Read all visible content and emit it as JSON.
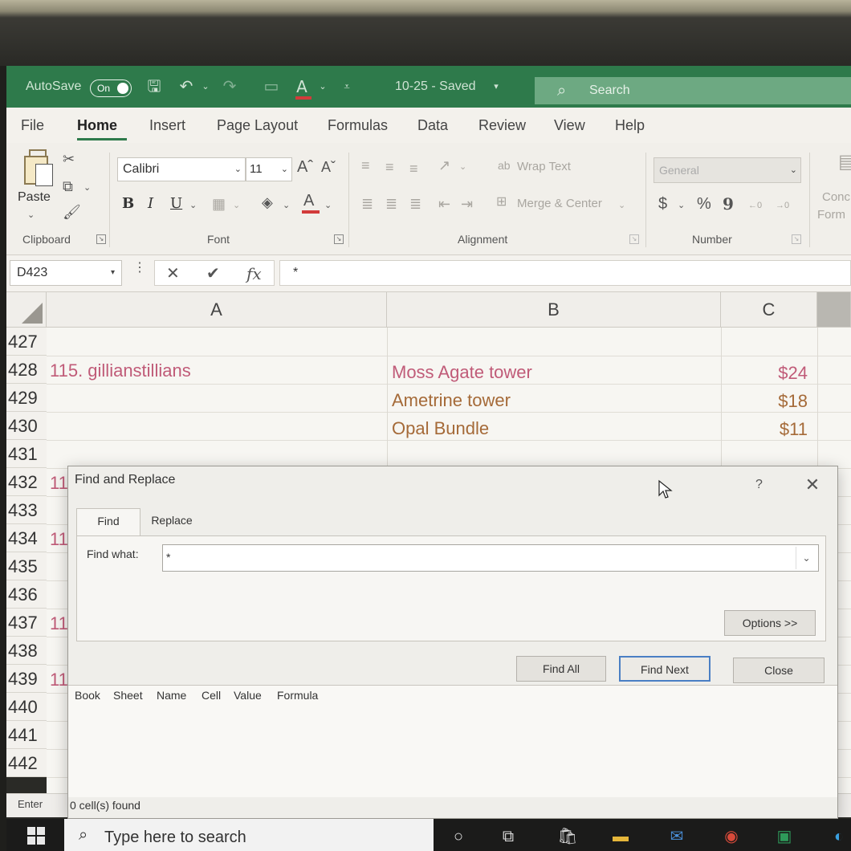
{
  "titlebar": {
    "autosave_label": "AutoSave",
    "autosave_state": "On",
    "doc_title": "10-25 - Saved",
    "search_placeholder": "Search"
  },
  "ribbon_tabs": [
    "File",
    "Home",
    "Insert",
    "Page Layout",
    "Formulas",
    "Data",
    "Review",
    "View",
    "Help"
  ],
  "active_tab": "Home",
  "ribbon": {
    "clipboard": {
      "paste_label": "Paste",
      "group_label": "Clipboard"
    },
    "font": {
      "family": "Calibri",
      "size": "11",
      "group_label": "Font",
      "bold": "B",
      "italic": "I",
      "underline": "U"
    },
    "alignment": {
      "wrap_text": "Wrap Text",
      "merge_center": "Merge & Center",
      "group_label": "Alignment"
    },
    "number": {
      "format": "General",
      "currency": "$",
      "percent": "%",
      "comma": "9",
      "group_label": "Number"
    },
    "styles": {
      "conditional_label": "Conc",
      "format_label": "Form"
    }
  },
  "formula_bar": {
    "name_box": "D423",
    "formula": "*",
    "cancel": "✕",
    "enter": "✔",
    "fx": "fx"
  },
  "sheet": {
    "columns": [
      "A",
      "B",
      "C"
    ],
    "rows": [
      {
        "num": "427",
        "a": "",
        "b": "",
        "c": ""
      },
      {
        "num": "428",
        "a": "115. gillianstillians",
        "b": "Moss Agate tower",
        "c": "$24"
      },
      {
        "num": "429",
        "a": "",
        "b": "Ametrine tower",
        "c": "$18"
      },
      {
        "num": "430",
        "a": "",
        "b": "Opal Bundle",
        "c": "$11"
      },
      {
        "num": "431",
        "a": "",
        "b": "",
        "c": ""
      },
      {
        "num": "432",
        "a": "11",
        "b": "",
        "c": ""
      },
      {
        "num": "433",
        "a": "",
        "b": "",
        "c": ""
      },
      {
        "num": "434",
        "a": "11",
        "b": "",
        "c": ""
      },
      {
        "num": "435",
        "a": "",
        "b": "",
        "c": ""
      },
      {
        "num": "436",
        "a": "",
        "b": "",
        "c": ""
      },
      {
        "num": "437",
        "a": "11",
        "b": "",
        "c": ""
      },
      {
        "num": "438",
        "a": "",
        "b": "",
        "c": ""
      },
      {
        "num": "439",
        "a": "11",
        "b": "",
        "c": ""
      },
      {
        "num": "440",
        "a": "",
        "b": "",
        "c": ""
      },
      {
        "num": "441",
        "a": "",
        "b": "",
        "c": ""
      },
      {
        "num": "442",
        "a": "",
        "b": "",
        "c": ""
      }
    ]
  },
  "status_bar": {
    "mode": "Enter"
  },
  "dialog": {
    "title": "Find and Replace",
    "help": "?",
    "close_icon": "✕",
    "tabs": [
      "Find",
      "Replace"
    ],
    "find_label": "Find what:",
    "find_value": "*",
    "options_button": "Options >>",
    "find_all_button": "Find All",
    "find_next_button": "Find Next",
    "close_button": "Close",
    "results_columns": [
      "Book",
      "Sheet",
      "Name",
      "Cell",
      "Value",
      "Formula"
    ],
    "status": "0 cell(s) found"
  },
  "taskbar": {
    "search_placeholder": "Type here to search"
  },
  "colors": {
    "excel_green": "#2e7a4b",
    "pink_text": "#c05b78",
    "brown_text": "#a56a38",
    "primary_button_border": "#4a7fc4"
  }
}
